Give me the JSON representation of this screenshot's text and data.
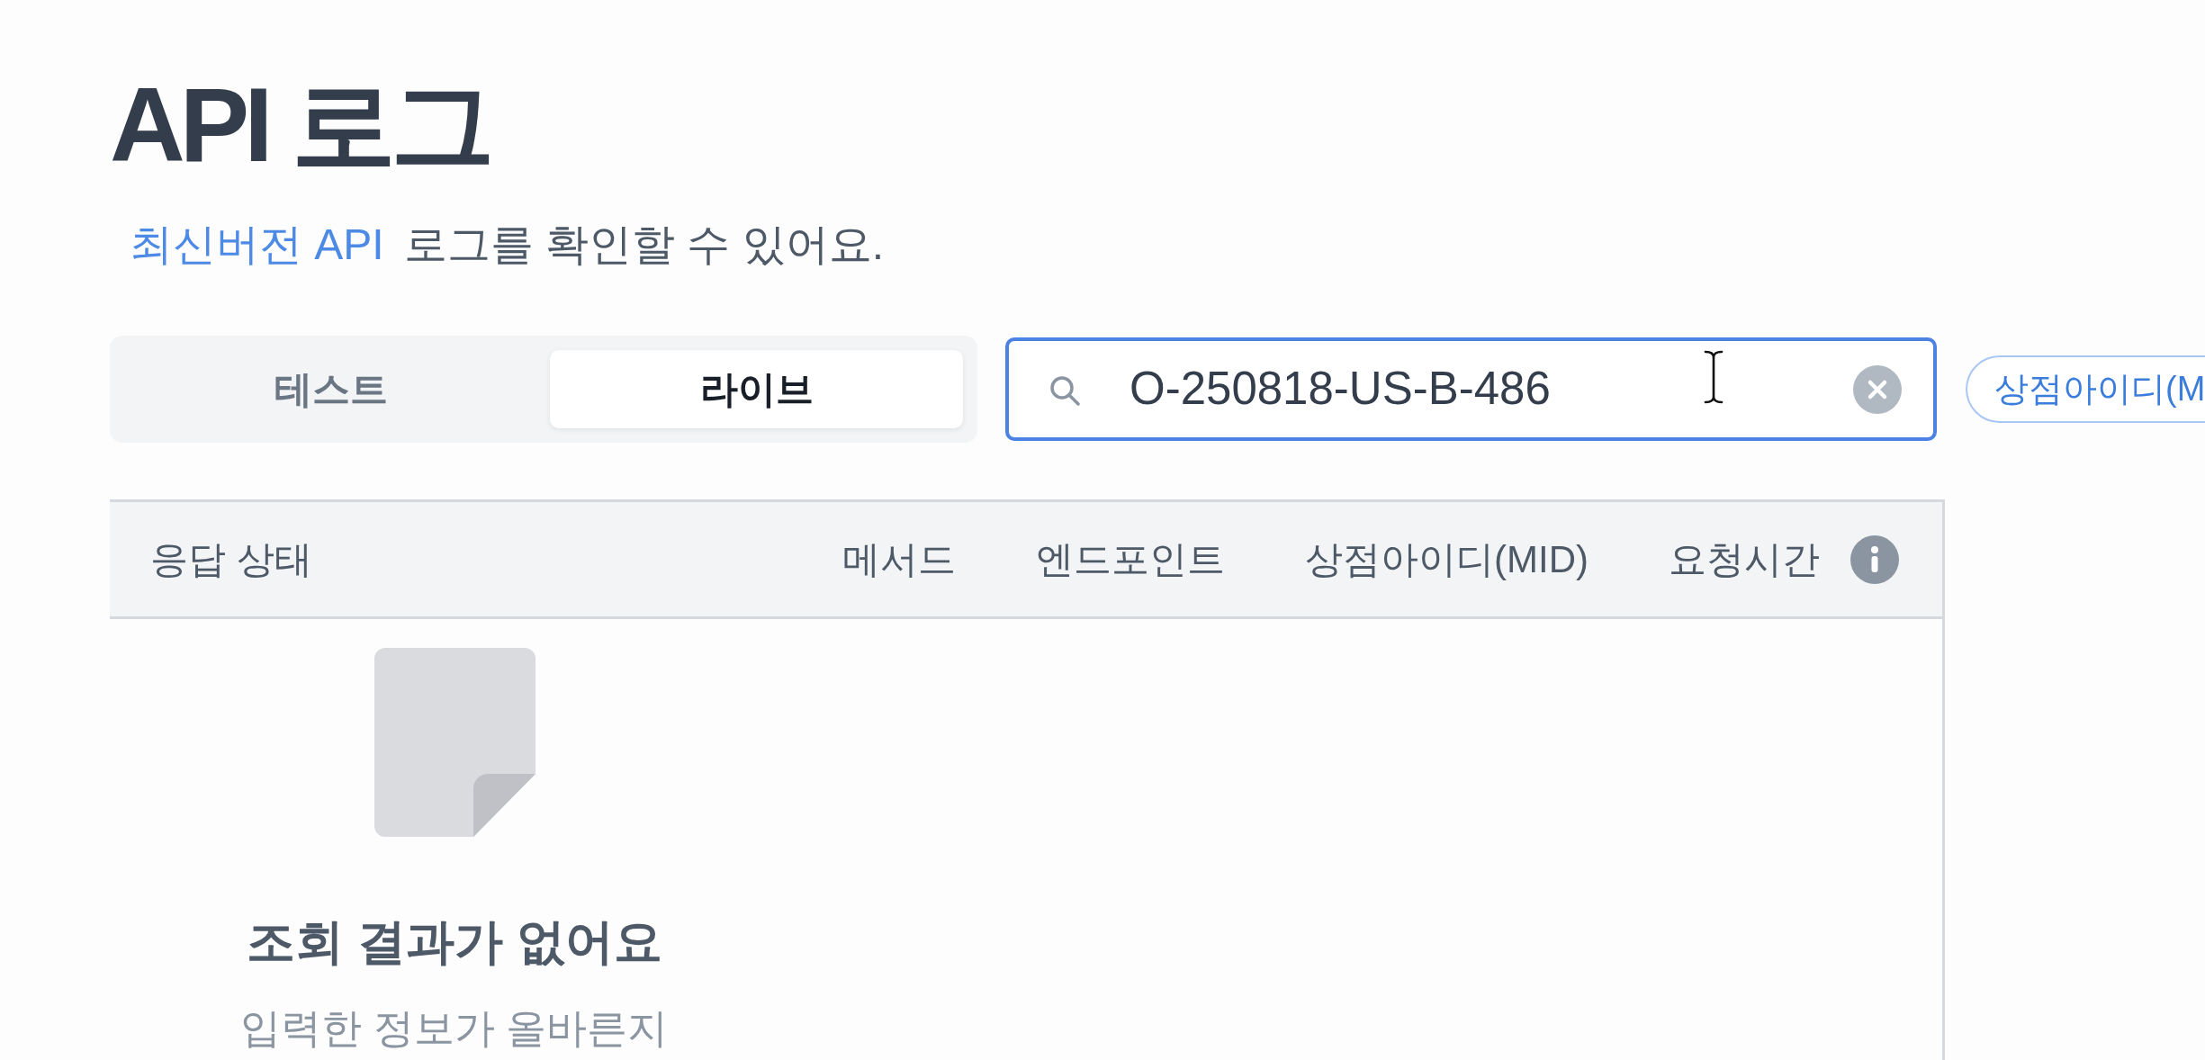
{
  "page": {
    "title": "API 로그",
    "description": {
      "link": "최신버전 API",
      "text": "로그를 확인할 수 있어요."
    }
  },
  "env_tabs": [
    {
      "label": "테스트",
      "selected": false
    },
    {
      "label": "라이브",
      "selected": true
    }
  ],
  "search": {
    "value": "O-250818-US-B-486"
  },
  "filter_chips": [
    {
      "label": "상점아이디(M"
    }
  ],
  "table": {
    "columns": [
      {
        "label": "응답 상태",
        "info_icon": false
      },
      {
        "label": "메서드",
        "info_icon": false
      },
      {
        "label": "엔드포인트",
        "info_icon": false
      },
      {
        "label": "상점아이디(MID)",
        "info_icon": false
      },
      {
        "label": "요청시간",
        "info_icon": true
      }
    ],
    "empty_state": {
      "title": "조회 결과가 없어요",
      "message": "입력한 정보가 올바른지"
    }
  }
}
